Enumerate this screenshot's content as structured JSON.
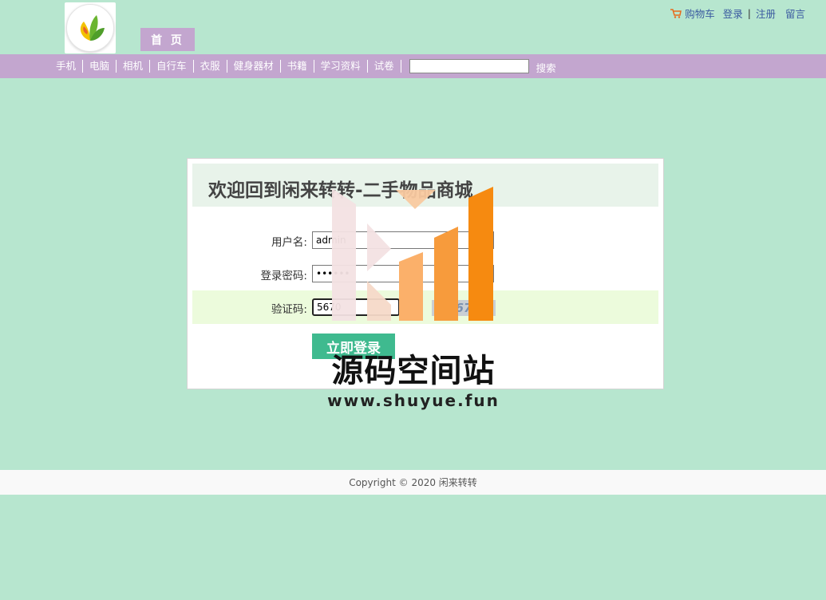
{
  "header": {
    "home_tab": "首 页",
    "top_links": {
      "cart": "购物车",
      "login": "登录",
      "register": "注册",
      "message": "留言",
      "separator": "|"
    }
  },
  "nav": {
    "items": [
      "手机",
      "电脑",
      "相机",
      "自行车",
      "衣服",
      "健身器材",
      "书籍",
      "学习资料",
      "试卷"
    ],
    "search_value": "",
    "search_button": "搜索"
  },
  "login": {
    "title": "欢迎回到闲来转转-二手物品商城",
    "username_label": "用户名:",
    "username_value": "admin",
    "password_label": "登录密码:",
    "password_value": "••••••",
    "captcha_label": "验证码:",
    "captcha_value": "5670",
    "captcha_image_text": "5670",
    "submit": "立即登录"
  },
  "watermark": {
    "title": "源码空间站",
    "url": "www.shuyue.fun"
  },
  "footer": {
    "copyright": "Copyright © 2020 闲来转转"
  },
  "colors": {
    "background": "#b7e6cf",
    "nav": "#c3a6cf",
    "button": "#3fba8f",
    "header_band": "#e8f3ea",
    "captcha_row": "#ecfbdc"
  }
}
